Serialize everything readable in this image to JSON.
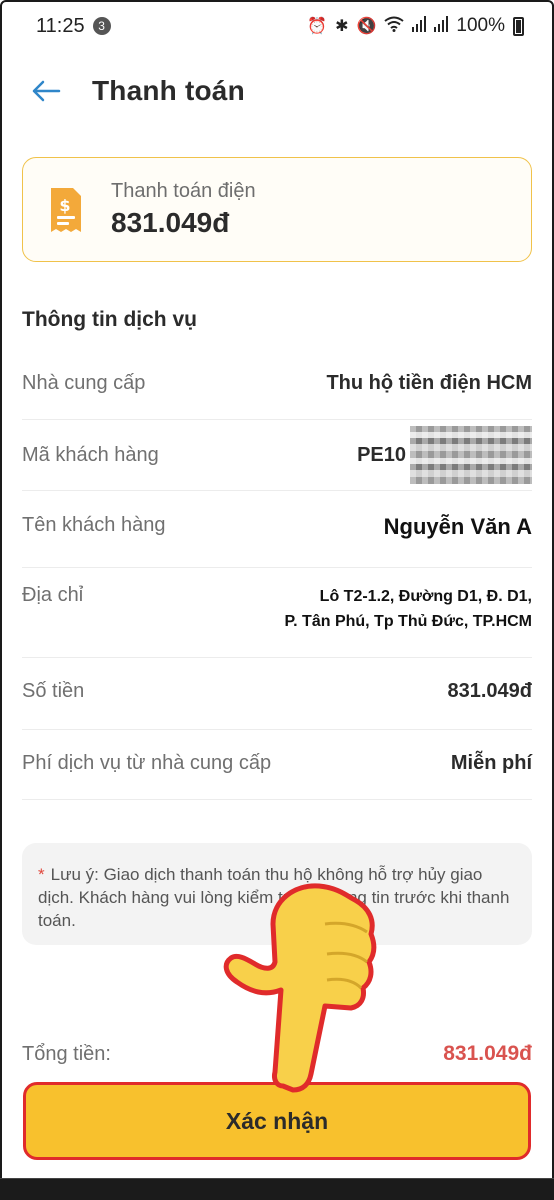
{
  "status_bar": {
    "time": "11:25",
    "notification_count": "3",
    "battery": "100%"
  },
  "header": {
    "title": "Thanh toán"
  },
  "bill": {
    "label": "Thanh toán điện",
    "amount": "831.049đ"
  },
  "section": {
    "title": "Thông tin dịch vụ"
  },
  "info": {
    "provider_label": "Nhà cung cấp",
    "provider_value": "Thu hộ tiền điện HCM",
    "customer_code_label": "Mã khách hàng",
    "customer_code_value": "PE10",
    "customer_name_label": "Tên khách hàng",
    "customer_name_value": "Nguyễn Văn A",
    "address_label": "Địa chỉ",
    "address_line1": "Lô T2-1.2, Đường D1, Đ. D1,",
    "address_line2": "P. Tân Phú, Tp Thủ Đức, TP.HCM",
    "amount_label": "Số tiền",
    "amount_value": "831.049đ",
    "fee_label": "Phí dịch vụ từ nhà cung cấp",
    "fee_value": "Miễn phí"
  },
  "note": {
    "star": "*",
    "text": "Lưu ý: Giao dịch thanh toán thu hộ không hỗ trợ hủy giao dịch. Khách hàng vui lòng kiểm tra kỹ thông tin trước khi thanh toán."
  },
  "total": {
    "label": "Tổng tiền:",
    "amount": "831.049đ"
  },
  "confirm_button": {
    "label": "Xác nhận"
  },
  "colors": {
    "accent_yellow": "#f8c12d",
    "card_border": "#f0c24a",
    "total_red": "#d9534f",
    "highlight_border": "#e02b2b",
    "back_arrow": "#2f86c9"
  }
}
